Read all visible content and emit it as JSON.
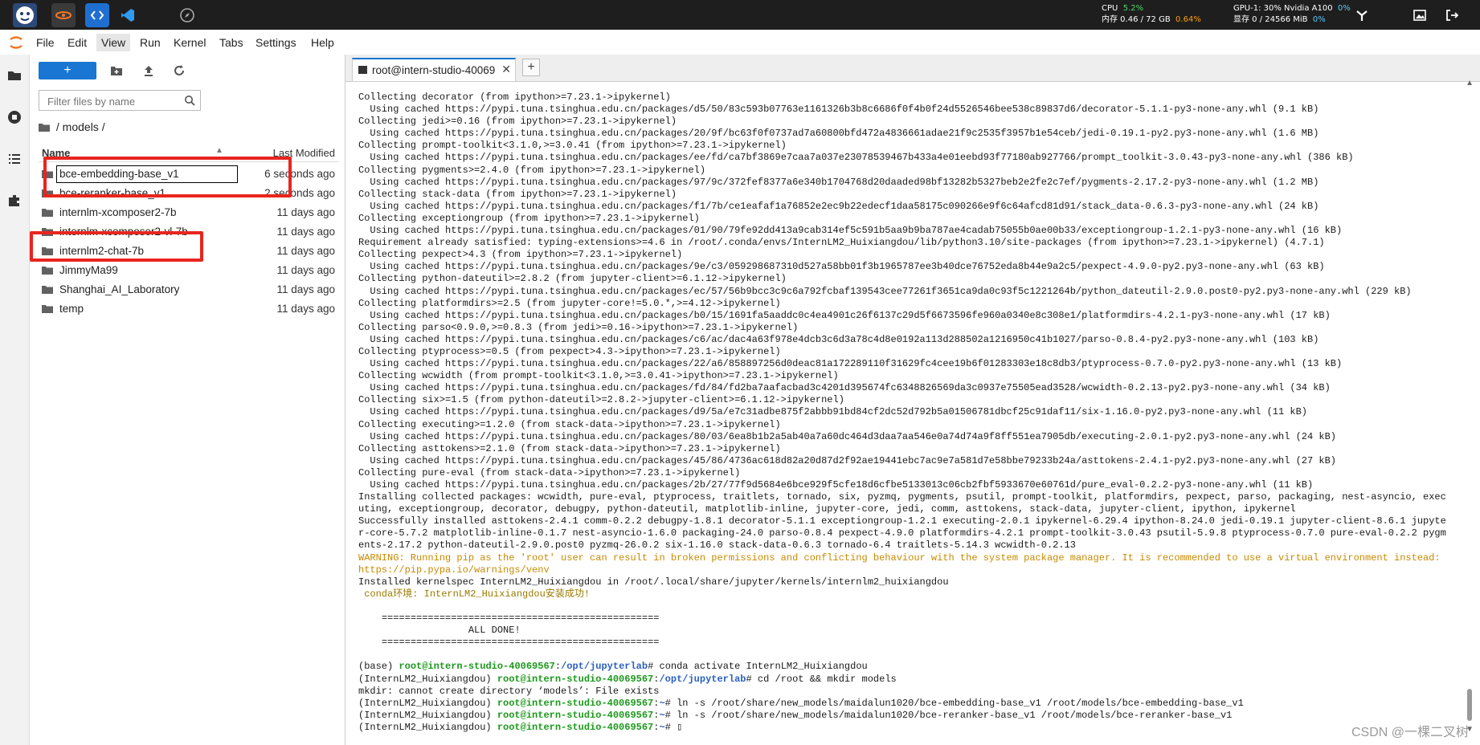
{
  "stats": {
    "cpu_label": "CPU",
    "cpu_val": "5.2%",
    "mem_label": "内存 0.46 / 72 GB",
    "mem_val": "0.64%",
    "gpu_label": "GPU-1: 30% Nvidia A100",
    "gpu_val": "0%",
    "vram_label": "显存 0 / 24566 MiB",
    "vram_val": "0%"
  },
  "menu": [
    "File",
    "Edit",
    "View",
    "Run",
    "Kernel",
    "Tabs",
    "Settings",
    "Help"
  ],
  "browser": {
    "new_label": "+",
    "filter_placeholder": "Filter files by name",
    "breadcrumb": "/ models /",
    "col_name": "Name",
    "col_modified": "Last Modified",
    "rows": [
      {
        "name": "bce-embedding-base_v1",
        "modified": "6 seconds ago"
      },
      {
        "name": "bce-reranker-base_v1",
        "modified": "2 seconds ago"
      },
      {
        "name": "internlm-xcomposer2-7b",
        "modified": "11 days ago"
      },
      {
        "name": "internlm-xcomposer2-vl-7b",
        "modified": "11 days ago"
      },
      {
        "name": "internlm2-chat-7b",
        "modified": "11 days ago"
      },
      {
        "name": "JimmyMa99",
        "modified": "11 days ago"
      },
      {
        "name": "Shanghai_AI_Laboratory",
        "modified": "11 days ago"
      },
      {
        "name": "temp",
        "modified": "11 days ago"
      }
    ]
  },
  "tab": {
    "label": "root@intern-studio-40069",
    "close": "✕",
    "add": "+"
  },
  "terminal": {
    "block1": "Collecting decorator (from ipython>=7.23.1->ipykernel)\n  Using cached https://pypi.tuna.tsinghua.edu.cn/packages/d5/50/83c593b07763e1161326b3b8c6686f0f4b0f24d5526546bee538c89837d6/decorator-5.1.1-py3-none-any.whl (9.1 kB)\nCollecting jedi>=0.16 (from ipython>=7.23.1->ipykernel)\n  Using cached https://pypi.tuna.tsinghua.edu.cn/packages/20/9f/bc63f0f0737ad7a60800bfd472a4836661adae21f9c2535f3957b1e54ceb/jedi-0.19.1-py2.py3-none-any.whl (1.6 MB)\nCollecting prompt-toolkit<3.1.0,>=3.0.41 (from ipython>=7.23.1->ipykernel)\n  Using cached https://pypi.tuna.tsinghua.edu.cn/packages/ee/fd/ca7bf3869e7caa7a037e23078539467b433a4e01eebd93f77180ab927766/prompt_toolkit-3.0.43-py3-none-any.whl (386 kB)\nCollecting pygments>=2.4.0 (from ipython>=7.23.1->ipykernel)\n  Using cached https://pypi.tuna.tsinghua.edu.cn/packages/97/9c/372fef8377a6e340b1704768d20daaded98bf13282b5327beb2e2fe2c7ef/pygments-2.17.2-py3-none-any.whl (1.2 MB)\nCollecting stack-data (from ipython>=7.23.1->ipykernel)\n  Using cached https://pypi.tuna.tsinghua.edu.cn/packages/f1/7b/ce1eafaf1a76852e2ec9b22edecf1daa58175c090266e9f6c64afcd81d91/stack_data-0.6.3-py3-none-any.whl (24 kB)\nCollecting exceptiongroup (from ipython>=7.23.1->ipykernel)\n  Using cached https://pypi.tuna.tsinghua.edu.cn/packages/01/90/79fe92dd413a9cab314ef5c591b5aa9b9ba787ae4cadab75055b0ae00b33/exceptiongroup-1.2.1-py3-none-any.whl (16 kB)\nRequirement already satisfied: typing-extensions>=4.6 in /root/.conda/envs/InternLM2_Huixiangdou/lib/python3.10/site-packages (from ipython>=7.23.1->ipykernel) (4.7.1)\nCollecting pexpect>4.3 (from ipython>=7.23.1->ipykernel)\n  Using cached https://pypi.tuna.tsinghua.edu.cn/packages/9e/c3/059298687310d527a58bb01f3b1965787ee3b40dce76752eda8b44e9a2c5/pexpect-4.9.0-py2.py3-none-any.whl (63 kB)\nCollecting python-dateutil>=2.8.2 (from jupyter-client>=6.1.12->ipykernel)\n  Using cached https://pypi.tuna.tsinghua.edu.cn/packages/ec/57/56b9bcc3c9c6a792fcbaf139543cee77261f3651ca9da0c93f5c1221264b/python_dateutil-2.9.0.post0-py2.py3-none-any.whl (229 kB)\nCollecting platformdirs>=2.5 (from jupyter-core!=5.0.*,>=4.12->ipykernel)\n  Using cached https://pypi.tuna.tsinghua.edu.cn/packages/b0/15/1691fa5aaddc0c4ea4901c26f6137c29d5f6673596fe960a0340e8c308e1/platformdirs-4.2.1-py3-none-any.whl (17 kB)\nCollecting parso<0.9.0,>=0.8.3 (from jedi>=0.16->ipython>=7.23.1->ipykernel)\n  Using cached https://pypi.tuna.tsinghua.edu.cn/packages/c6/ac/dac4a63f978e4dcb3c6d3a78c4d8e0192a113d288502a1216950c41b1027/parso-0.8.4-py2.py3-none-any.whl (103 kB)\nCollecting ptyprocess>=0.5 (from pexpect>4.3->ipython>=7.23.1->ipykernel)\n  Using cached https://pypi.tuna.tsinghua.edu.cn/packages/22/a6/858897256d0deac81a172289110f31629fc4cee19b6f01283303e18c8db3/ptyprocess-0.7.0-py2.py3-none-any.whl (13 kB)\nCollecting wcwidth (from prompt-toolkit<3.1.0,>=3.0.41->ipython>=7.23.1->ipykernel)\n  Using cached https://pypi.tuna.tsinghua.edu.cn/packages/fd/84/fd2ba7aafacbad3c4201d395674fc6348826569da3c0937e75505ead3528/wcwidth-0.2.13-py2.py3-none-any.whl (34 kB)\nCollecting six>=1.5 (from python-dateutil>=2.8.2->jupyter-client>=6.1.12->ipykernel)\n  Using cached https://pypi.tuna.tsinghua.edu.cn/packages/d9/5a/e7c31adbe875f2abbb91bd84cf2dc52d792b5a01506781dbcf25c91daf11/six-1.16.0-py2.py3-none-any.whl (11 kB)\nCollecting executing>=1.2.0 (from stack-data->ipython>=7.23.1->ipykernel)\n  Using cached https://pypi.tuna.tsinghua.edu.cn/packages/80/03/6ea8b1b2a5ab40a7a60dc464d3daa7aa546e0a74d74a9f8ff551ea7905db/executing-2.0.1-py2.py3-none-any.whl (24 kB)\nCollecting asttokens>=2.1.0 (from stack-data->ipython>=7.23.1->ipykernel)\n  Using cached https://pypi.tuna.tsinghua.edu.cn/packages/45/86/4736ac618d82a20d87d2f92ae19441ebc7ac9e7a581d7e58bbe79233b24a/asttokens-2.4.1-py2.py3-none-any.whl (27 kB)\nCollecting pure-eval (from stack-data->ipython>=7.23.1->ipykernel)\n  Using cached https://pypi.tuna.tsinghua.edu.cn/packages/2b/27/77f9d5684e6bce929f5cfe18d6cfbe5133013c06cb2fbf5933670e60761d/pure_eval-0.2.2-py3-none-any.whl (11 kB)\nInstalling collected packages: wcwidth, pure-eval, ptyprocess, traitlets, tornado, six, pyzmq, pygments, psutil, prompt-toolkit, platformdirs, pexpect, parso, packaging, nest-asyncio, executing, exceptiongroup, decorator, debugpy, python-dateutil, matplotlib-inline, jupyter-core, jedi, comm, asttokens, stack-data, jupyter-client, ipython, ipykernel\nSuccessfully installed asttokens-2.4.1 comm-0.2.2 debugpy-1.8.1 decorator-5.1.1 exceptiongroup-1.2.1 executing-2.0.1 ipykernel-6.29.4 ipython-8.24.0 jedi-0.19.1 jupyter-client-8.6.1 jupyter-core-5.7.2 matplotlib-inline-0.1.7 nest-asyncio-1.6.0 packaging-24.0 parso-0.8.4 pexpect-4.9.0 platformdirs-4.2.1 prompt-toolkit-3.0.43 psutil-5.9.8 ptyprocess-0.7.0 pure-eval-0.2.2 pygments-2.17.2 python-dateutil-2.9.0.post0 pyzmq-26.0.2 six-1.16.0 stack-data-0.6.3 tornado-6.4 traitlets-5.14.3 wcwidth-0.2.13",
    "warning": "WARNING: Running pip as the 'root' user can result in broken permissions and conflicting behaviour with the system package manager. It is recommended to use a virtual environment instead: https://pip.pypa.io/warnings/venv",
    "installed": "Installed kernelspec InternLM2_Huixiangdou in /root/.local/share/jupyter/kernels/internlm2_huixiangdou",
    "success": " conda环境: InternLM2_Huixiangdou安装成功!",
    "banner": "\n    ================================================\n                   ALL DONE!\n    ================================================\n",
    "prompts": [
      {
        "env": "(base) ",
        "host": "root@intern-studio-40069567",
        "path": "/opt/jupyterlab",
        "cmd": "# conda activate InternLM2_Huixiangdou"
      },
      {
        "env": "(InternLM2_Huixiangdou) ",
        "host": "root@intern-studio-40069567",
        "path": "/opt/jupyterlab",
        "cmd": "# cd /root && mkdir models"
      },
      {
        "env": "",
        "host": "",
        "path": "",
        "cmd": "mkdir: cannot create directory ‘models’: File exists"
      },
      {
        "env": "(InternLM2_Huixiangdou) ",
        "host": "root@intern-studio-40069567",
        "path": "~",
        "cmd": "# ln -s /root/share/new_models/maidalun1020/bce-embedding-base_v1 /root/models/bce-embedding-base_v1"
      },
      {
        "env": "(InternLM2_Huixiangdou) ",
        "host": "root@intern-studio-40069567",
        "path": "~",
        "cmd": "# ln -s /root/share/new_models/maidalun1020/bce-reranker-base_v1 /root/models/bce-reranker-base_v1"
      },
      {
        "env": "(InternLM2_Huixiangdou) ",
        "host": "root@intern-studio-40069567",
        "path": "~",
        "cmd": "# ▯"
      }
    ]
  },
  "watermark": "CSDN @一棵二叉树"
}
